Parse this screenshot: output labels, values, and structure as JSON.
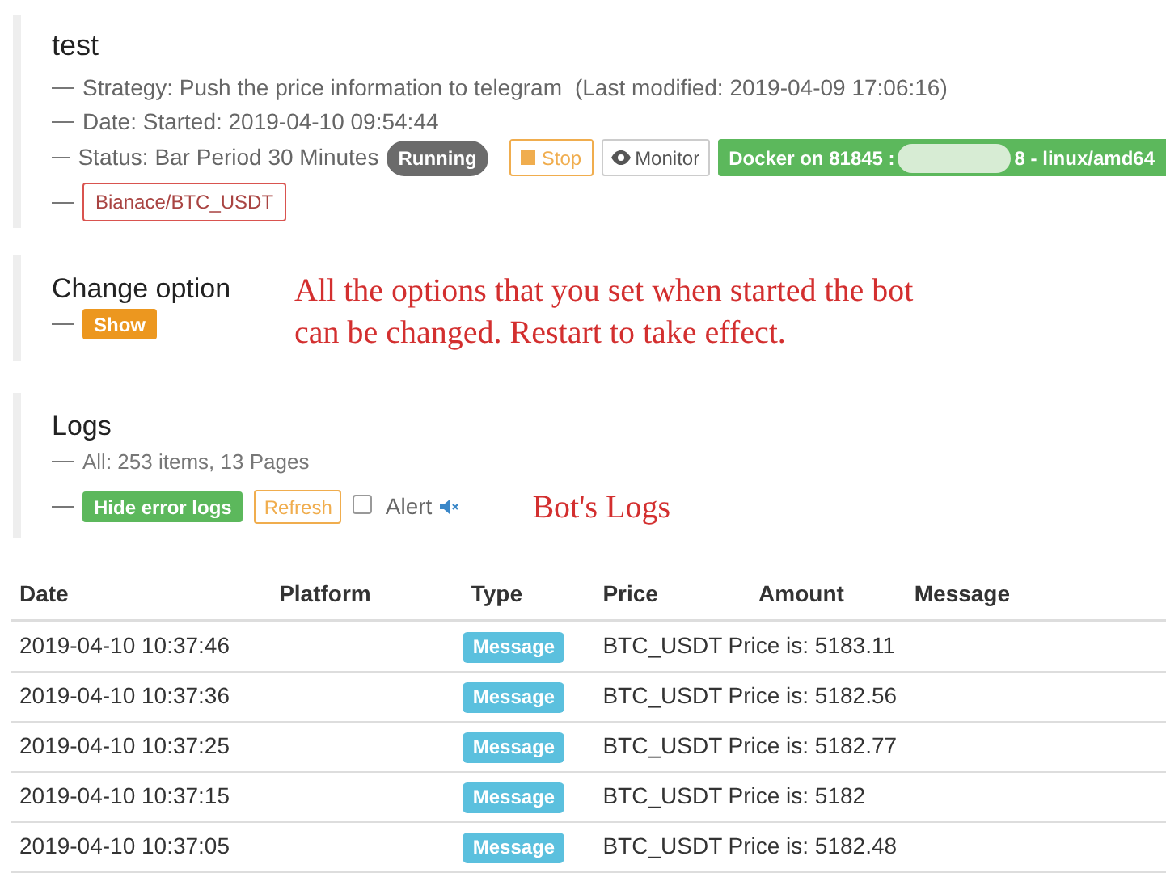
{
  "robot": {
    "title": "test",
    "strategy": "Strategy: Push the price information to telegram",
    "last_modified": "(Last modified: 2019-04-09 17:06:16)",
    "date": "Date: Started: 2019-04-10 09:54:44",
    "status_label": "Status: Bar Period 30 Minutes",
    "status_badge": "Running",
    "stop_button": "Stop",
    "monitor_button": "Monitor",
    "docker_start": "Docker on 81845 :",
    "docker_end": "8 - linux/amd64",
    "exchange": "Bianace/BTC_USDT"
  },
  "change_option": {
    "title": "Change option",
    "show_button": "Show",
    "annotation": "All the options that you set when started the bot can be changed. Restart to take effect."
  },
  "logs": {
    "title": "Logs",
    "summary": "All: 253 items, 13 Pages",
    "hide_button": "Hide error logs",
    "refresh_button": "Refresh",
    "alert": {
      "label": "Alert",
      "checked": false
    },
    "annotation": "Bot's Logs"
  },
  "table": {
    "columns": [
      "Date",
      "Platform",
      "Type",
      "Price",
      "Amount",
      "Message"
    ],
    "rows": [
      {
        "date": "2019-04-10 10:37:46",
        "type": "Message",
        "message": "BTC_USDT Price is: 5183.11"
      },
      {
        "date": "2019-04-10 10:37:36",
        "type": "Message",
        "message": "BTC_USDT Price is: 5182.56"
      },
      {
        "date": "2019-04-10 10:37:25",
        "type": "Message",
        "message": "BTC_USDT Price is: 5182.77"
      },
      {
        "date": "2019-04-10 10:37:15",
        "type": "Message",
        "message": "BTC_USDT Price is: 5182"
      },
      {
        "date": "2019-04-10 10:37:05",
        "type": "Message",
        "message": "BTC_USDT Price is: 5182.48"
      }
    ]
  }
}
